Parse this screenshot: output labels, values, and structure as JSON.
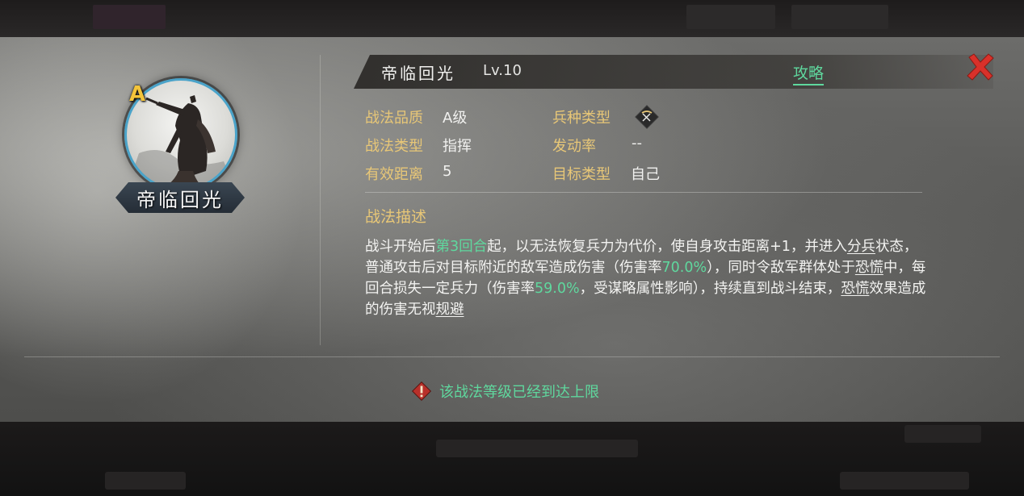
{
  "skill": {
    "grade": "A",
    "name": "帝临回光",
    "level": "Lv.10",
    "guide_label": "攻略"
  },
  "attributes": [
    {
      "label": "战法品质",
      "value": "A级"
    },
    {
      "label": "兵种类型",
      "value": "",
      "icon": "bow-icon"
    },
    {
      "label": "战法类型",
      "value": "指挥"
    },
    {
      "label": "发动率",
      "value": "--"
    },
    {
      "label": "有效距离",
      "value": "5"
    },
    {
      "label": "目标类型",
      "value": "自己"
    }
  ],
  "description": {
    "title": "战法描述",
    "segments": [
      {
        "text": "战斗开始后"
      },
      {
        "text": "第3回合",
        "style": "hl"
      },
      {
        "text": "起，以无法恢复兵力为代价，使自身攻击距离+1，并进入"
      },
      {
        "text": "分兵",
        "style": "kw"
      },
      {
        "text": "状态，普通攻击后对目标附近的敌军造成伤害（伤害率"
      },
      {
        "text": "70.0%",
        "style": "hl"
      },
      {
        "text": "），同时令敌军群体处于"
      },
      {
        "text": "恐慌",
        "style": "kw"
      },
      {
        "text": "中，每回合损失一定兵力（伤害率"
      },
      {
        "text": "59.0%",
        "style": "hl"
      },
      {
        "text": "，受谋略属性影响），持续直到战斗结束，"
      },
      {
        "text": "恐慌",
        "style": "kw"
      },
      {
        "text": "效果造成的伤害无视"
      },
      {
        "text": "规避",
        "style": "kw"
      }
    ]
  },
  "notice": {
    "text": "该战法等级已经到达上限",
    "icon": "warning-icon"
  },
  "colors": {
    "accent_green": "#5fd89e",
    "label_gold": "#e8c777",
    "close_red": "#d9312a",
    "grade_gold": "#f3c43a"
  }
}
